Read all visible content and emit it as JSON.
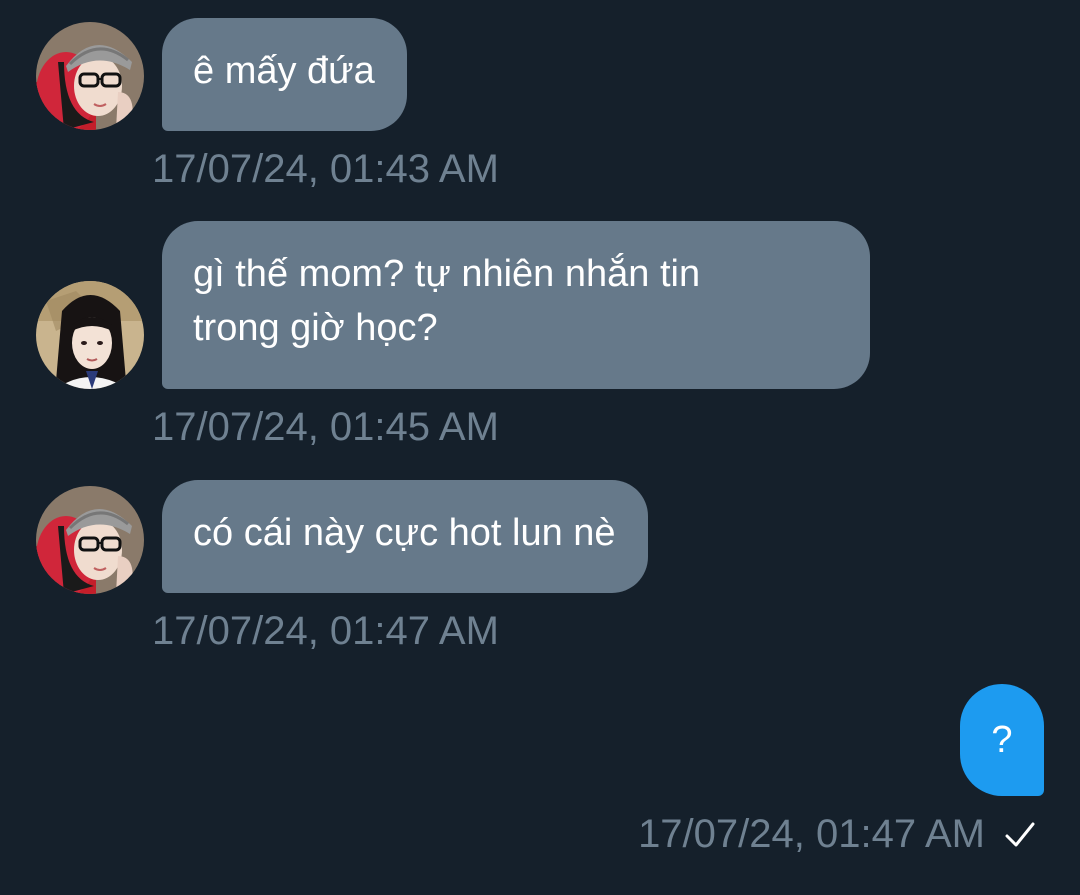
{
  "conversation": {
    "messages": [
      {
        "sender": "incoming",
        "avatar": "avatar-girl-beanie-glasses",
        "text": "ê mấy đứa",
        "time": "17/07/24, 01:43 AM"
      },
      {
        "sender": "incoming",
        "avatar": "avatar-girl-long-hair",
        "text": "gì thế mom? tự nhiên nhắn tin\ntrong giờ học?",
        "time": "17/07/24, 01:45 AM"
      },
      {
        "sender": "incoming",
        "avatar": "avatar-girl-beanie-glasses",
        "text": "có cái này cực hot lun nè",
        "time": "17/07/24, 01:47 AM"
      },
      {
        "sender": "outgoing",
        "text": "?",
        "time": "17/07/24, 01:47 AM",
        "status_icon": "check-icon"
      }
    ]
  },
  "colors": {
    "background": "#15202b",
    "incoming_bubble": "#66798a",
    "outgoing_bubble": "#1d9bf0",
    "timestamp": "#6f8191"
  }
}
